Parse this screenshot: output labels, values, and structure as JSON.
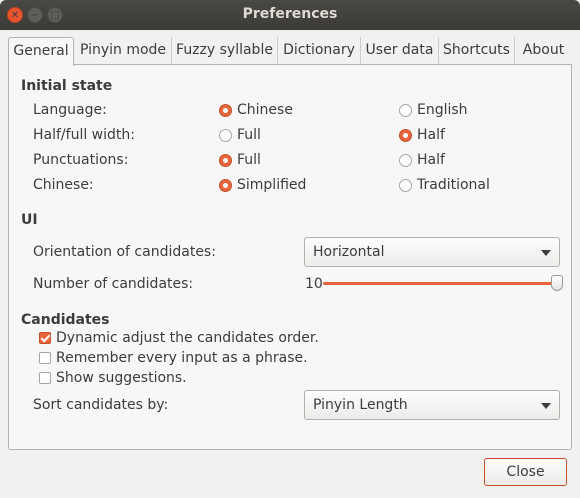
{
  "window": {
    "title": "Preferences"
  },
  "tabs": [
    {
      "label": "General"
    },
    {
      "label": "Pinyin mode"
    },
    {
      "label": "Fuzzy syllable"
    },
    {
      "label": "Dictionary"
    },
    {
      "label": "User data"
    },
    {
      "label": "Shortcuts"
    },
    {
      "label": "About"
    }
  ],
  "initial_state": {
    "heading": "Initial state",
    "rows": [
      {
        "label": "Language:",
        "opt1": "Chinese",
        "opt2": "English",
        "selected": 1
      },
      {
        "label": "Half/full width:",
        "opt1": "Full",
        "opt2": "Half",
        "selected": 2
      },
      {
        "label": "Punctuations:",
        "opt1": "Full",
        "opt2": "Half",
        "selected": 1
      },
      {
        "label": "Chinese:",
        "opt1": "Simplified",
        "opt2": "Traditional",
        "selected": 1
      }
    ]
  },
  "ui": {
    "heading": "UI",
    "orientation_label": "Orientation of candidates:",
    "orientation_value": "Horizontal",
    "number_label": "Number of candidates:",
    "number_value": "10"
  },
  "candidates": {
    "heading": "Candidates",
    "options": [
      {
        "label": "Dynamic adjust the candidates order.",
        "checked": true
      },
      {
        "label": "Remember every input as a phrase.",
        "checked": false
      },
      {
        "label": "Show suggestions.",
        "checked": false
      }
    ],
    "sort_label": "Sort candidates by:",
    "sort_value": "Pinyin Length"
  },
  "footer": {
    "close_label": "Close"
  },
  "colors": {
    "accent": "#e8643b",
    "titlebar": "#3c3b37"
  }
}
